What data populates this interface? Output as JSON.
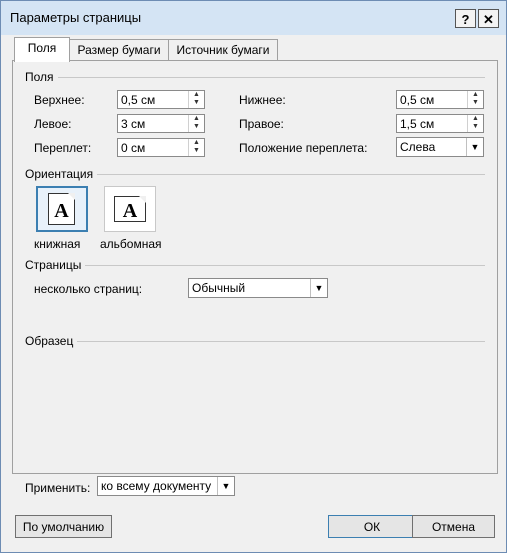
{
  "window": {
    "title": "Параметры страницы",
    "help_label": "?",
    "close_label": "✕"
  },
  "tabs": [
    {
      "label": "Поля",
      "active": true
    },
    {
      "label": "Размер бумаги",
      "active": false
    },
    {
      "label": "Источник бумаги",
      "active": false
    }
  ],
  "margins": {
    "group_label": "Поля",
    "top": {
      "label": "Верхнее:",
      "value": "0,5 см"
    },
    "bottom": {
      "label": "Нижнее:",
      "value": "0,5 см"
    },
    "left": {
      "label": "Левое:",
      "value": "3 см"
    },
    "right": {
      "label": "Правое:",
      "value": "1,5 см"
    },
    "gutter": {
      "label": "Переплет:",
      "value": "0 см"
    },
    "gutter_position": {
      "label": "Положение переплета:",
      "value": "Слева"
    }
  },
  "orientation": {
    "group_label": "Ориентация",
    "portrait": {
      "label": "книжная",
      "glyph": "A",
      "selected": true
    },
    "landscape": {
      "label": "альбомная",
      "glyph": "A",
      "selected": false
    }
  },
  "pages": {
    "group_label": "Страницы",
    "multiple_label": "несколько страниц:",
    "multiple_value": "Обычный"
  },
  "preview": {
    "group_label": "Образец"
  },
  "apply": {
    "label": "Применить:",
    "value": "ко всему документу"
  },
  "buttons": {
    "default": "По умолчанию",
    "ok": "ОК",
    "cancel": "Отмена"
  },
  "icons": {
    "spin_up": "arrow-up-icon",
    "spin_down": "arrow-down-icon",
    "dropdown": "chevron-down-icon"
  },
  "colors": {
    "selection_border": "#3c7fb1",
    "title_bar": "#d4e4f4"
  }
}
